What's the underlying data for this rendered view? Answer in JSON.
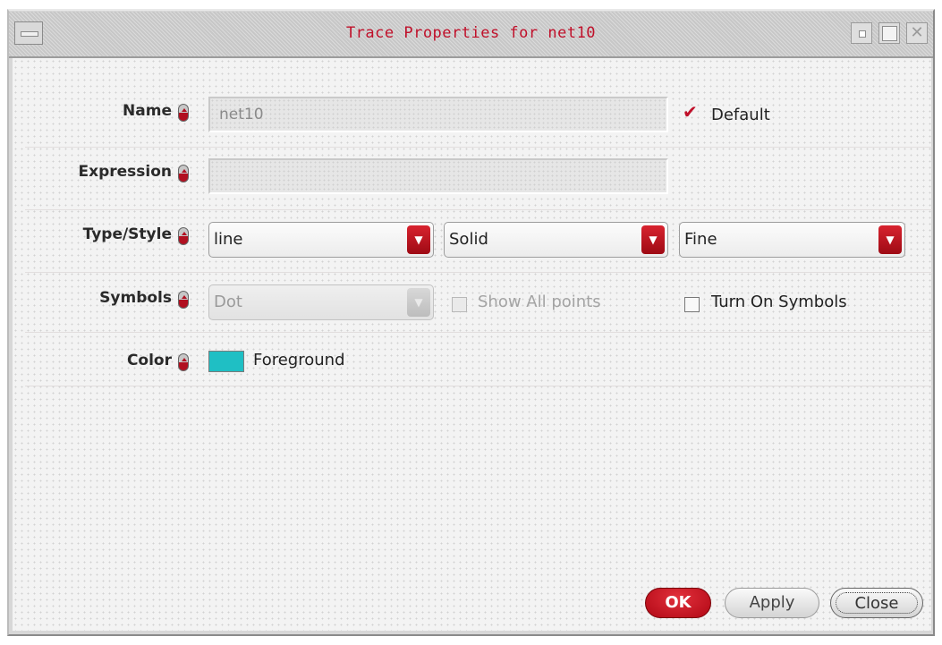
{
  "window": {
    "title": "Trace Properties for net10"
  },
  "form": {
    "name": {
      "label": "Name",
      "value": "net10",
      "default_label": "Default",
      "default_checked": true
    },
    "expression": {
      "label": "Expression",
      "value": ""
    },
    "type_style": {
      "label": "Type/Style",
      "type": "line",
      "style": "Solid",
      "width": "Fine"
    },
    "symbols": {
      "label": "Symbols",
      "symbol": "Dot",
      "show_all_points_label": "Show All points",
      "turn_on_symbols_label": "Turn On Symbols"
    },
    "color": {
      "label": "Color",
      "name": "Foreground",
      "swatch": "#1fbfc4"
    }
  },
  "buttons": {
    "ok": "OK",
    "apply": "Apply",
    "close": "Close"
  },
  "colors": {
    "accent": "#c0102a"
  }
}
